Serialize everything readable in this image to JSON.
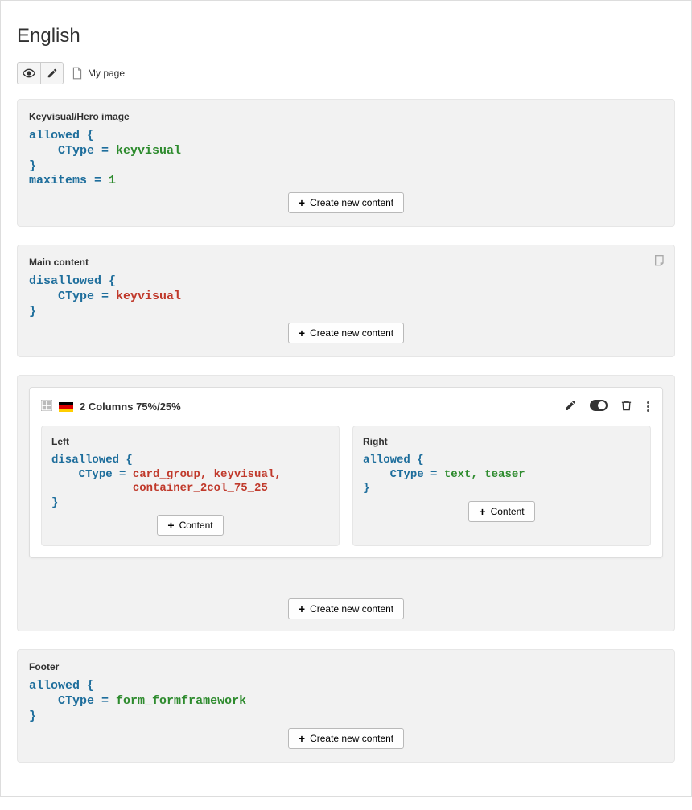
{
  "header": {
    "title": "English",
    "page_name": "My page"
  },
  "buttons": {
    "create_new_content": "Create new content",
    "content": "Content"
  },
  "zones": {
    "hero": {
      "title": "Keyvisual/Hero image",
      "code_html": "<span class='k-blue'>allowed {</span>\n    <span class='k-blue'>CType =</span> <span class='k-green'>keyvisual</span>\n<span class='k-blue'>}</span>\n<span class='k-blue'>maxitems =</span> <span class='k-green'>1</span>"
    },
    "main": {
      "title": "Main content",
      "code_html": "<span class='k-blue'>disallowed {</span>\n    <span class='k-blue'>CType =</span> <span class='k-red'>keyvisual</span>\n<span class='k-blue'>}</span>"
    },
    "container": {
      "title": "2 Columns 75%/25%",
      "left": {
        "title": "Left",
        "code_html": "<span class='k-blue'>disallowed {</span>\n    <span class='k-blue'>CType =</span> <span class='k-red'>card_group, keyvisual,</span>\n            <span class='k-red'>container_2col_75_25</span>\n<span class='k-blue'>}</span>"
      },
      "right": {
        "title": "Right",
        "code_html": "<span class='k-blue'>allowed {</span>\n    <span class='k-blue'>CType =</span> <span class='k-green'>text, teaser</span>\n<span class='k-blue'>}</span>"
      }
    },
    "footer": {
      "title": "Footer",
      "code_html": "<span class='k-blue'>allowed {</span>\n    <span class='k-blue'>CType =</span> <span class='k-green'>form_formframework</span>\n<span class='k-blue'>}</span>"
    }
  }
}
